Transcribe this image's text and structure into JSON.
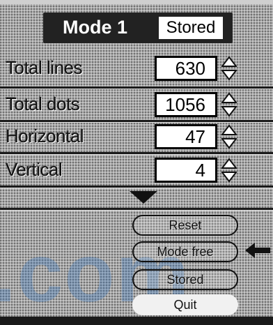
{
  "colors": {
    "panel": "#a9a9a9",
    "header_bg": "#222222",
    "watermark": "#3c78be"
  },
  "header": {
    "title": "Mode 1",
    "badge": "Stored"
  },
  "rows": [
    {
      "label": "Total lines",
      "value": "630"
    },
    {
      "label": "Total dots",
      "value": "1056"
    },
    {
      "label": "Horizontal",
      "value": "47"
    },
    {
      "label": "Vertical",
      "value": "4"
    }
  ],
  "buttons": {
    "reset": "Reset",
    "mode_free": "Mode free",
    "stored": "Stored",
    "quit": "Quit"
  },
  "icons": {
    "stepper": "up-down-stepper-icon",
    "more": "down-triangle-icon",
    "pointer": "left-arrow-icon"
  },
  "watermark": ".com"
}
